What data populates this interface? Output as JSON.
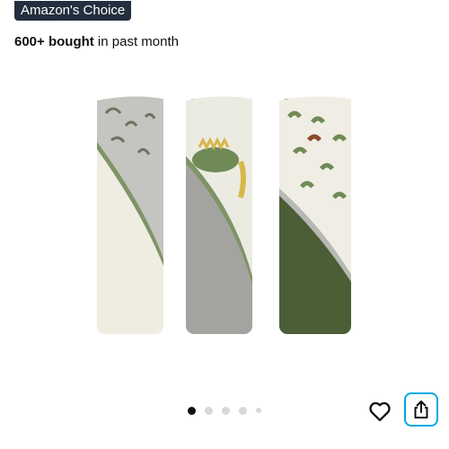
{
  "badge": {
    "label": "Amazon's Choice"
  },
  "social_proof": {
    "count": "600+ bought",
    "suffix": " in past month"
  },
  "gallery": {
    "image_alt": "Set of three rolled hooded baby towels with dinosaur prints",
    "dot_count": 5,
    "active_index": 0
  },
  "icons": {
    "favorite": "heart-icon",
    "share": "share-icon"
  },
  "colors": {
    "badge_bg": "#232f3e",
    "share_border": "#00a8e1",
    "towel_green": "#4b5e36"
  }
}
